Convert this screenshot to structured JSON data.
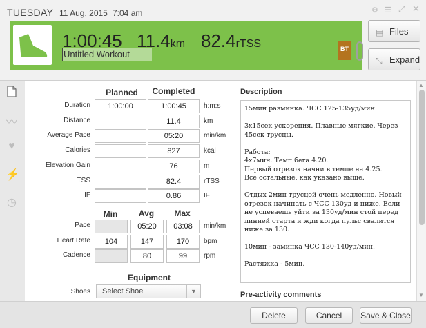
{
  "header": {
    "day": "TUESDAY",
    "date": "11 Aug, 2015",
    "time": "7:04 am",
    "duration": "1:00:45",
    "distance_value": "11.4",
    "distance_unit": "km",
    "tss_value": "82.4",
    "tss_unit": "rTSS",
    "workout_name": "Untitled Workout",
    "bt_badge": "BT",
    "files_label": "Files",
    "expand_label": "Expand",
    "accent_color": "#7dc14a",
    "badge_color": "#b4741f"
  },
  "table": {
    "planned_header": "Planned",
    "completed_header": "Completed",
    "rows": [
      {
        "label": "Duration",
        "planned": "1:00:00",
        "completed": "1:00:45",
        "unit": "h:m:s"
      },
      {
        "label": "Distance",
        "planned": "",
        "completed": "11.4",
        "unit": "km"
      },
      {
        "label": "Average Pace",
        "planned": "",
        "completed": "05:20",
        "unit": "min/km"
      },
      {
        "label": "Calories",
        "planned": "",
        "completed": "827",
        "unit": "kcal"
      },
      {
        "label": "Elevation Gain",
        "planned": "",
        "completed": "76",
        "unit": "m"
      },
      {
        "label": "TSS",
        "planned": "",
        "completed": "82.4",
        "unit": "rTSS"
      },
      {
        "label": "IF",
        "planned": "",
        "completed": "0.86",
        "unit": "IF"
      }
    ]
  },
  "minmax": {
    "min_header": "Min",
    "avg_header": "Avg",
    "max_header": "Max",
    "rows": [
      {
        "label": "Pace",
        "min": "",
        "avg": "05:20",
        "max": "03:08",
        "unit": "min/km"
      },
      {
        "label": "Heart Rate",
        "min": "104",
        "avg": "147",
        "max": "170",
        "unit": "bpm"
      },
      {
        "label": "Cadence",
        "min": "",
        "avg": "80",
        "max": "99",
        "unit": "rpm"
      }
    ]
  },
  "equipment": {
    "header": "Equipment",
    "shoes_label": "Shoes",
    "shoes_value": "Select Shoe"
  },
  "description": {
    "header": "Description",
    "paragraphs": [
      "15мин разминка. ЧСС 125-135уд/мин.",
      "3х15сек ускорения. Плавные мягкие. Через 45сек трусцы.",
      "Работа:\n4х7мин. Темп бега 4.20.\nПервый отрезок начни в темпе на 4.25.\nВсе остальные, как указано выше.",
      "Отдых 2мин трусцой очень медленно. Новый отрезок начинать с ЧСС 130уд и ниже. Если не успеваешь уйти за 130уд/мин стой перед линией старта и жди когда пульс свалится ниже за 130.",
      "10мин - заминка ЧСС 130-140уд/мин.",
      "Растяжка - 5мин."
    ]
  },
  "pre_activity": {
    "header": "Pre-activity comments"
  },
  "footer": {
    "delete_label": "Delete",
    "cancel_label": "Cancel",
    "save_close_label": "Save & Close"
  }
}
